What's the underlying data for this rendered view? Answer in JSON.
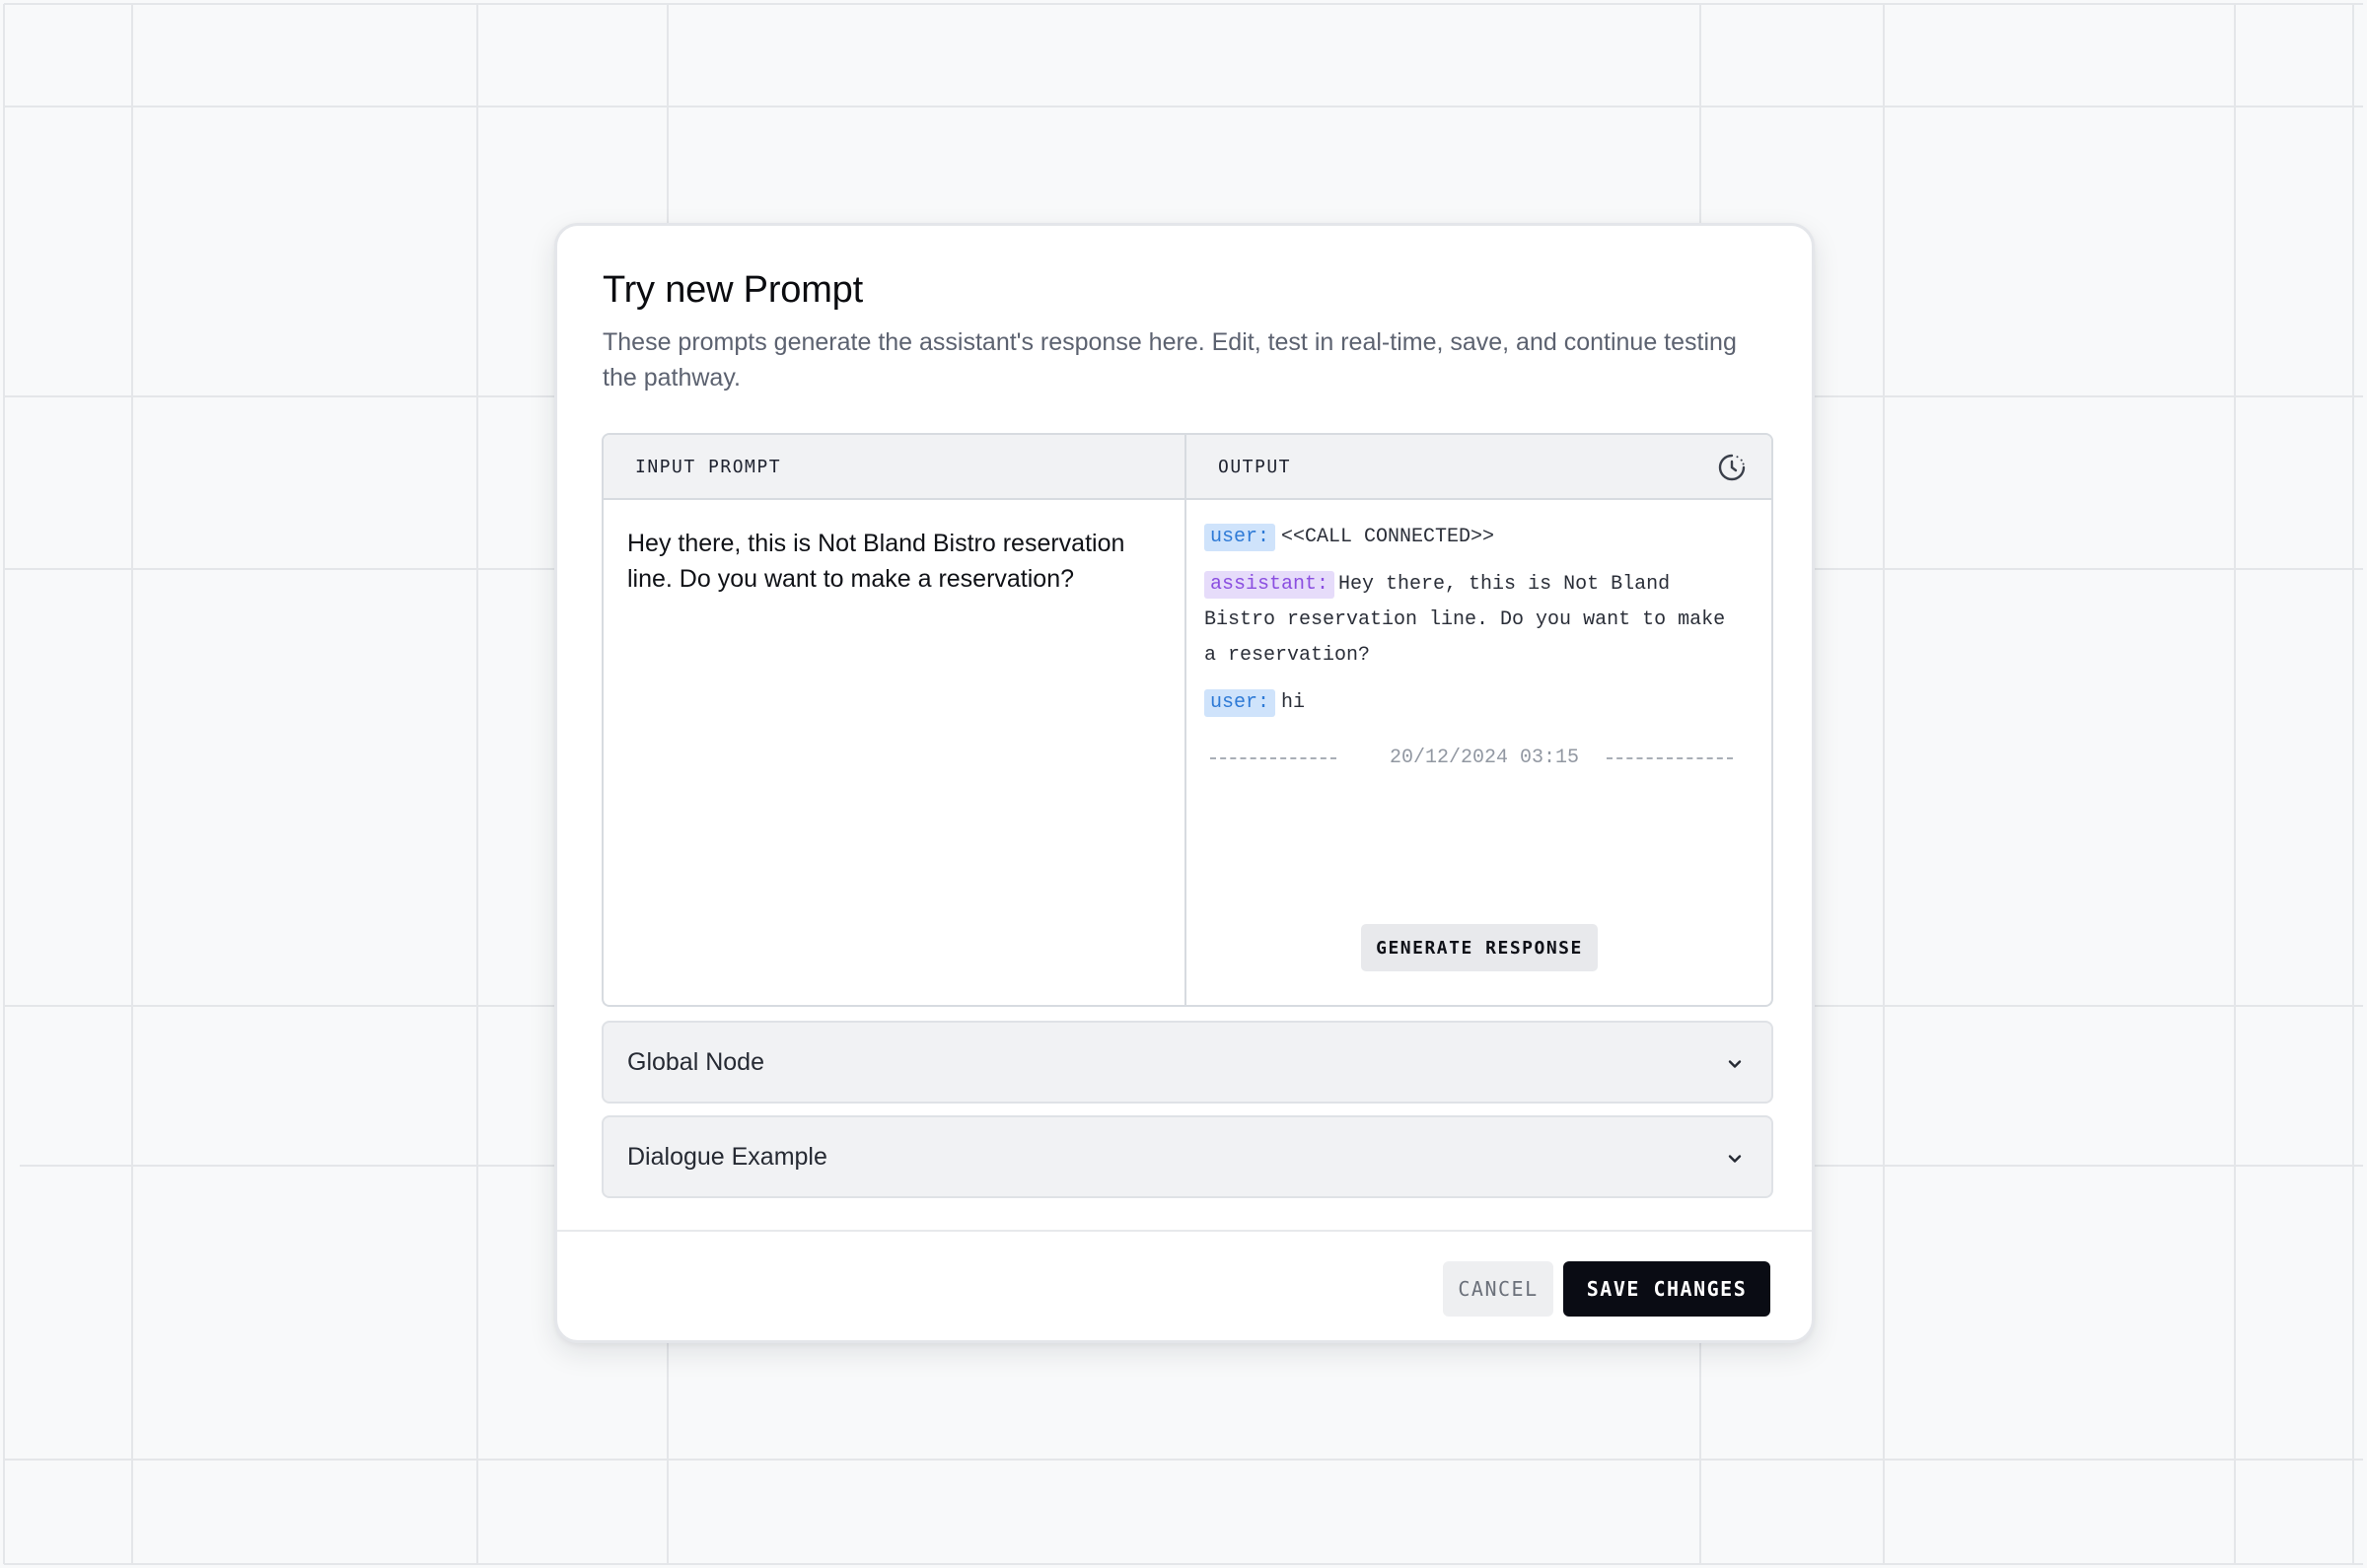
{
  "modal": {
    "title": "Try new Prompt",
    "description": "These prompts generate the assistant's response here. Edit, test in real-time, save, and continue testing the pathway."
  },
  "prompt_panel": {
    "input_header": "INPUT PROMPT",
    "output_header": "OUTPUT",
    "history_icon": "history-clock-icon",
    "input_text": "Hey there, this is Not Bland Bistro reservation line. Do you want to make a reservation?",
    "transcript": [
      {
        "role": "user:",
        "text": "<<CALL CONNECTED>>"
      },
      {
        "role": "assistant:",
        "text": "Hey there, this is Not Bland Bistro reservation line. Do you want to make a reservation?"
      },
      {
        "role": "user:",
        "text": "hi"
      }
    ],
    "timestamp": "20/12/2024 03:15",
    "generate_button": "GENERATE RESPONSE"
  },
  "accordions": [
    {
      "label": "Global Node",
      "icon": "chevron-down-icon"
    },
    {
      "label": "Dialogue Example",
      "icon": "chevron-down-icon"
    }
  ],
  "footer": {
    "cancel_label": "CANCEL",
    "save_label": "SAVE CHANGES"
  },
  "colors": {
    "background": "#f8f9fa",
    "grid_line": "#e4e6e9",
    "user_role_bg": "#cfe3fb",
    "user_role_text": "#2e7ad6",
    "assistant_role_bg": "#e6dcfa",
    "assistant_role_text": "#8b4fe0",
    "save_button": "#0a0c14"
  }
}
